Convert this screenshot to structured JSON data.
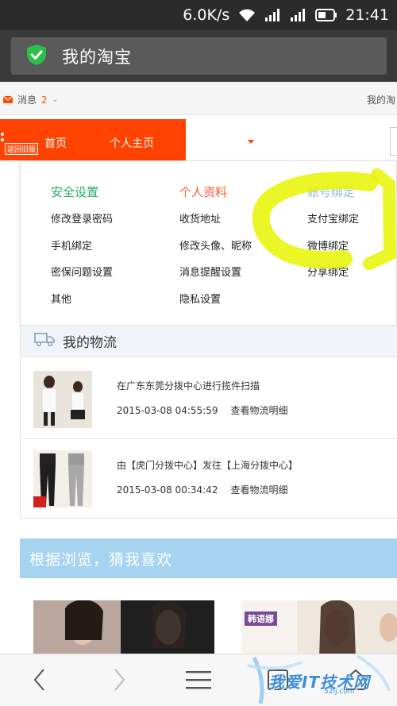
{
  "status_bar": {
    "speed": "6.0K/s",
    "time": "21:41"
  },
  "title_bar": {
    "title": "我的淘宝"
  },
  "topbar": {
    "messages_label": "消息",
    "messages_count": "2",
    "right_link": "我的淘"
  },
  "nav": {
    "back_label": "返回旧版",
    "home_label": "首页",
    "personal_label": "个人主页"
  },
  "dropdown": {
    "columns": [
      {
        "heading": "安全设置",
        "items": [
          "修改登录密码",
          "手机绑定",
          "密保问题设置",
          "其他"
        ]
      },
      {
        "heading": "个人资料",
        "items": [
          "收货地址",
          "修改头像、昵称",
          "消息提醒设置",
          "隐私设置"
        ]
      },
      {
        "heading": "账号绑定",
        "items": [
          "支付宝绑定",
          "微博绑定",
          "分享绑定"
        ]
      }
    ]
  },
  "logistics": {
    "title": "我的物流",
    "rows": [
      {
        "status": "在广东东莞分拨中心进行揽件扫描",
        "time": "2015-03-08 04:55:59",
        "link": "查看物流明细"
      },
      {
        "status": "由【虎门分拨中心】发往【上海分拨中心】",
        "time": "2015-03-08 00:34:42",
        "link": "查看物流明细"
      }
    ]
  },
  "recommend": {
    "title": "根据浏览，猜我喜欢",
    "brand_badge": "韩语娜"
  },
  "bottom_nav": {
    "tab_count": "8"
  },
  "watermark": {
    "text": "我爱IT技术网",
    "sub": "52ij.com"
  },
  "colors": {
    "accent": "#ff4200",
    "security": "#2aa86a",
    "profile": "#ff5a3a",
    "binding": "#8fb8dd",
    "recommend_bar": "#a6d4f0"
  }
}
